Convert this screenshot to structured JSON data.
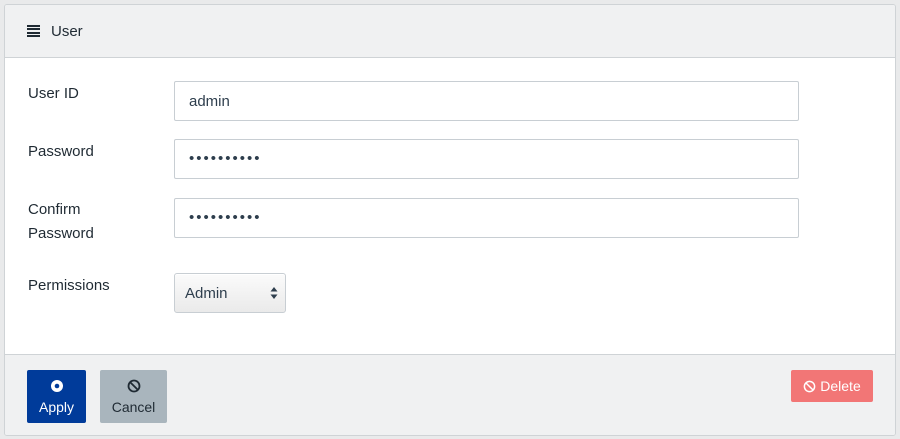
{
  "panel": {
    "title": "User",
    "title_icon": "list-icon"
  },
  "form": {
    "user_id": {
      "label": "User ID",
      "value": "admin"
    },
    "password": {
      "label": "Password",
      "value": "••••••••••"
    },
    "confirm_password": {
      "label_line1": "Confirm",
      "label_line2": "Password",
      "value": "••••••••••"
    },
    "permissions": {
      "label": "Permissions",
      "selected": "Admin",
      "icon": "sort-caret-icon"
    }
  },
  "footer": {
    "apply": {
      "label": "Apply",
      "icon": "radio-dot-icon",
      "color": "#003b9a"
    },
    "cancel": {
      "label": "Cancel",
      "icon": "ban-icon",
      "color": "#a9b5bd"
    },
    "delete": {
      "label": "Delete",
      "icon": "ban-icon",
      "color": "#f27676"
    }
  }
}
